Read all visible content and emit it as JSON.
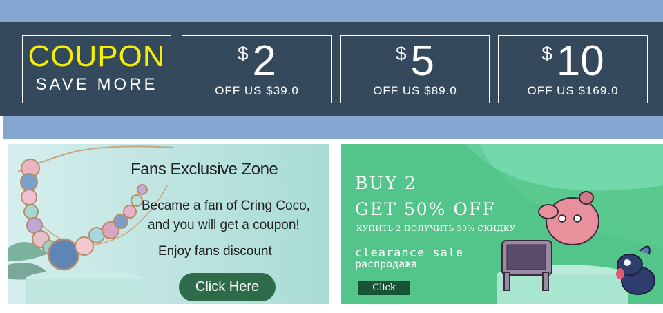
{
  "coupon_header": {
    "title": "COUPON",
    "subtitle": "SAVE MORE"
  },
  "coupons": [
    {
      "currency": "$",
      "amount": "2",
      "condition": "OFF US $39.0"
    },
    {
      "currency": "$",
      "amount": "5",
      "condition": "OFF US $89.0"
    },
    {
      "currency": "$",
      "amount": "10",
      "condition": "OFF US $169.0"
    }
  ],
  "fans_banner": {
    "title": "Fans Exclusive Zone",
    "line1": "Became a fan of Cring Coco,",
    "line2": "and you will get a coupon!",
    "line3": "Enjoy fans discount",
    "button_label": "Click Here",
    "image": "necklace-photo"
  },
  "sale_banner": {
    "line1": "BUY 2",
    "line2": "GET 50% OFF",
    "line3": "КУПИТЬ 2 ПОЛУЧИТЬ 50% СКИДКУ",
    "line4": "clearance sale",
    "line5": "распродажа",
    "button_label": "Click",
    "image": "dog-brooches"
  },
  "colors": {
    "band": "#86a6d2",
    "coupon_bg": "#34495b",
    "coupon_title": "#f5f000",
    "fans_button": "#2d6b4a",
    "sale_bg": "#59c98e",
    "sale_button": "#195234"
  }
}
